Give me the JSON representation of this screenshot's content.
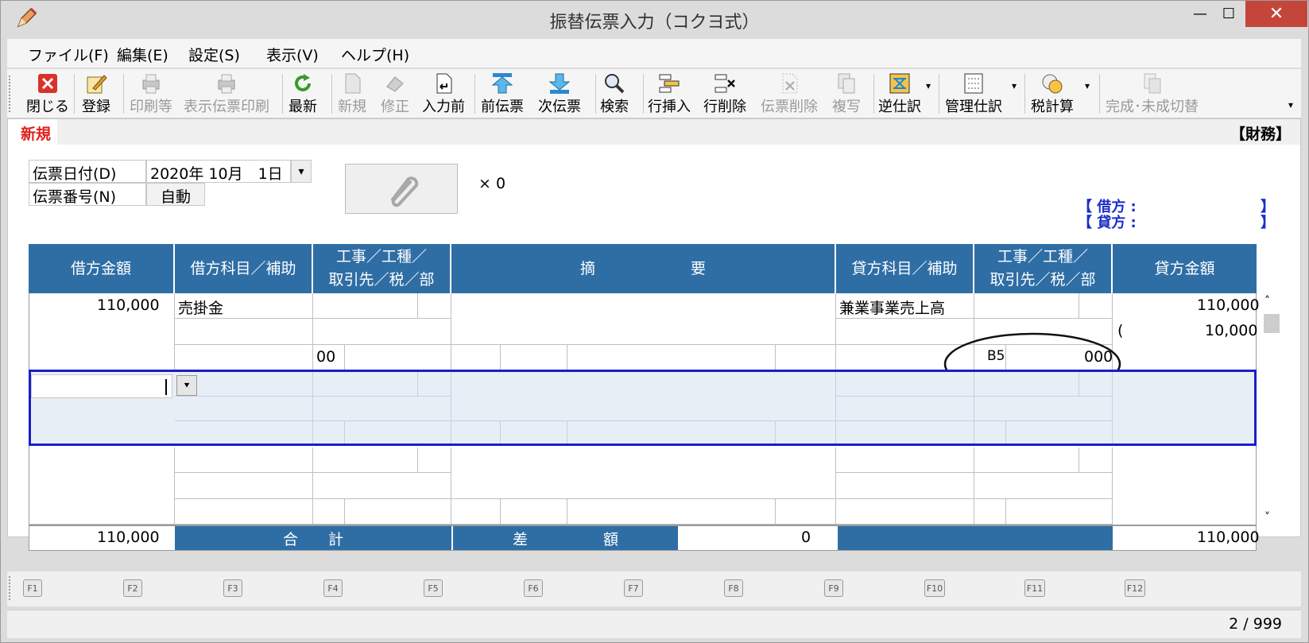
{
  "window": {
    "title": "振替伝票入力（コクヨ式）",
    "min": "—",
    "max": "☐",
    "close": "✕"
  },
  "menu": [
    "ファイル(F)",
    "編集(E)",
    "設定(S)",
    "表示(V)",
    "ヘルプ(H)"
  ],
  "toolbar": {
    "close": "閉じる",
    "register": "登録",
    "print": "印刷等",
    "print_view": "表示伝票印刷",
    "latest": "最新",
    "new": "新規",
    "fix": "修正",
    "before_input": "入力前",
    "prev": "前伝票",
    "next": "次伝票",
    "search": "検索",
    "row_insert": "行挿入",
    "row_delete": "行削除",
    "slip_delete": "伝票削除",
    "copy": "複写",
    "reverse": "逆仕訳",
    "manage": "管理仕訳",
    "tax_calc": "税計算",
    "toggle": "完成･未成切替"
  },
  "mode": {
    "label": "新規",
    "book": "【財務】"
  },
  "form": {
    "date_label": "伝票日付(D)",
    "date_value": "2020年 10月　1日",
    "number_label": "伝票番号(N)",
    "number_value": "自動",
    "attach_count": "× 0"
  },
  "summary": {
    "debit_label": "【 借方 :",
    "credit_label": "【 貸方 :",
    "close_bracket": "】"
  },
  "columns": {
    "debit_amount": "借方金額",
    "debit_account": "借方科目／補助",
    "debit_project_1": "工事／工種／",
    "debit_project_2": "取引先／税／部",
    "memo_1": "摘",
    "memo_2": "要",
    "credit_account": "貸方科目／補助",
    "credit_project_1": "工事／工種／",
    "credit_project_2": "取引先／税／部",
    "credit_amount": "貸方金額"
  },
  "rows": {
    "r1_debit_amount": "110,000",
    "r1_debit_account": "売掛金",
    "r1_debit_tax": "00",
    "r1_credit_account": "兼業事業売上高",
    "r1_credit_tax": "B5",
    "r1_credit_tax_value": "000",
    "r1_credit_amount": "110,000",
    "r1_credit_paren": "(",
    "r1_credit_tax_amount": "10,000"
  },
  "totals": {
    "debit_total": "110,000",
    "total_label": "合　　計",
    "diff_label": "差　　　　　額",
    "diff_value": "0",
    "credit_total": "110,000"
  },
  "fkeys": [
    "F1",
    "F2",
    "F3",
    "F4",
    "F5",
    "F6",
    "F7",
    "F8",
    "F9",
    "F10",
    "F11",
    "F12"
  ],
  "status": {
    "page": "2 / 999"
  },
  "colors": {
    "header": "#2f6ea5",
    "mode": "#e0201c",
    "select": "#1a1ec8",
    "summary": "#1a2ec8"
  }
}
